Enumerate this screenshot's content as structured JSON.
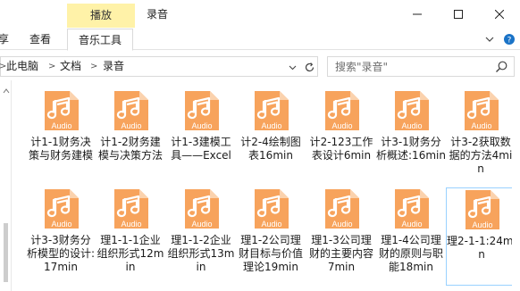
{
  "titlebar": {
    "context_tab": "播放",
    "title": "录音",
    "buttons": {
      "minimize": "minimize-icon",
      "maximize": "maximize-icon",
      "close": "close-icon"
    }
  },
  "ribbon": {
    "tabs": [
      {
        "label": "享"
      },
      {
        "label": "查看"
      },
      {
        "label": "音乐工具",
        "active": true
      }
    ],
    "collapse_icon": "chevron-down-icon",
    "help_icon": "help-icon"
  },
  "address": {
    "crumbs": [
      "此电脑",
      "文档",
      "录音"
    ],
    "separator": ">",
    "search_placeholder": "搜索\"录音\""
  },
  "files": [
    {
      "badge": "Audio",
      "name": "计1-1财务决策与财务建模"
    },
    {
      "badge": "Audio",
      "name": "计1-2财务建模与决策方法"
    },
    {
      "badge": "Audio",
      "name": "计1-3建模工具——Excel"
    },
    {
      "badge": "Audio",
      "name": "计2-4绘制图表16min"
    },
    {
      "badge": "Audio",
      "name": "计2-123工作表设计6min"
    },
    {
      "badge": "Audio",
      "name": "计3-1财务分析概述:16min"
    },
    {
      "badge": "Audio",
      "name": "计3-2获取数据的方法4min"
    },
    {
      "badge": "Audio",
      "name": "计3-3财务分析模型的设计:17min"
    },
    {
      "badge": "Audio",
      "name": "理1-1-1企业组织形式12min"
    },
    {
      "badge": "Audio",
      "name": "理1-1-2企业组织形式13min"
    },
    {
      "badge": "Audio",
      "name": "理1-2公司理财目标与价值理论19min"
    },
    {
      "badge": "Audio",
      "name": "理1-3公司理财的主要内容7min"
    },
    {
      "badge": "Audio",
      "name": "理1-4公司理财的原则与职能18min"
    },
    {
      "badge": "Audio",
      "name": "理2-1-1:24min",
      "selected": true
    }
  ],
  "colors": {
    "audio_icon": "#f7a35c",
    "context_tab": "#fff2a8",
    "selection_border": "#99d1ff"
  }
}
